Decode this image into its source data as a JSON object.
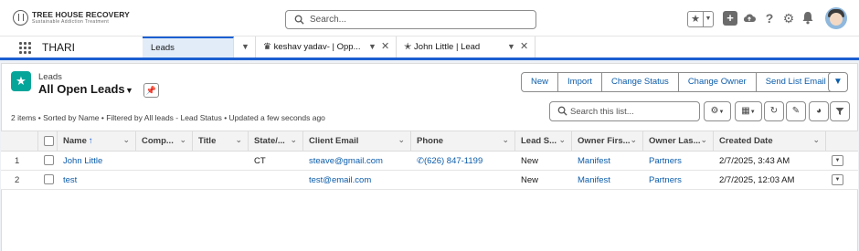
{
  "brand": {
    "name": "TREE HOUSE RECOVERY",
    "tagline": "Sustainable Addiction Treatment"
  },
  "global_search": {
    "placeholder": "Search..."
  },
  "header_icons": [
    "favorites-star-icon",
    "add-icon",
    "cloud-setup-icon",
    "help-icon",
    "setup-gear-icon",
    "notifications-bell-icon",
    "user-avatar"
  ],
  "app": {
    "name": "THARI"
  },
  "tabs": [
    {
      "label": "Leads",
      "active": true
    },
    {
      "label": "keshav yadav- | Opp...",
      "active": false
    },
    {
      "label": "John Little | Lead",
      "active": false
    }
  ],
  "list_view": {
    "object_label": "Leads",
    "title": "All Open Leads",
    "meta": "2 items • Sorted by Name • Filtered by All leads - Lead Status • Updated a few seconds ago",
    "search_placeholder": "Search this list...",
    "actions": [
      "New",
      "Import",
      "Change Status",
      "Change Owner",
      "Send List Email"
    ]
  },
  "columns": [
    "Name",
    "Comp...",
    "Title",
    "State/...",
    "Client Email",
    "Phone",
    "Lead S...",
    "Owner Firs...",
    "Owner Las...",
    "Created Date"
  ],
  "rows": [
    {
      "num": "1",
      "name": "John Little",
      "company": "",
      "title": "",
      "state": "CT",
      "email": "steave@gmail.com",
      "phone": "(626) 847-1199",
      "lead_status": "New",
      "owner_first": "Manifest",
      "owner_last": "Partners",
      "created": "2/7/2025, 3:43 AM"
    },
    {
      "num": "2",
      "name": "test",
      "company": "",
      "title": "",
      "state": "",
      "email": "test@email.com",
      "phone": "",
      "lead_status": "New",
      "owner_first": "Manifest",
      "owner_last": "Partners",
      "created": "2/7/2025, 12:03 AM"
    }
  ],
  "colors": {
    "accent": "#1b5fd1",
    "link": "#0b5cab",
    "lead_icon": "#06a59a"
  }
}
